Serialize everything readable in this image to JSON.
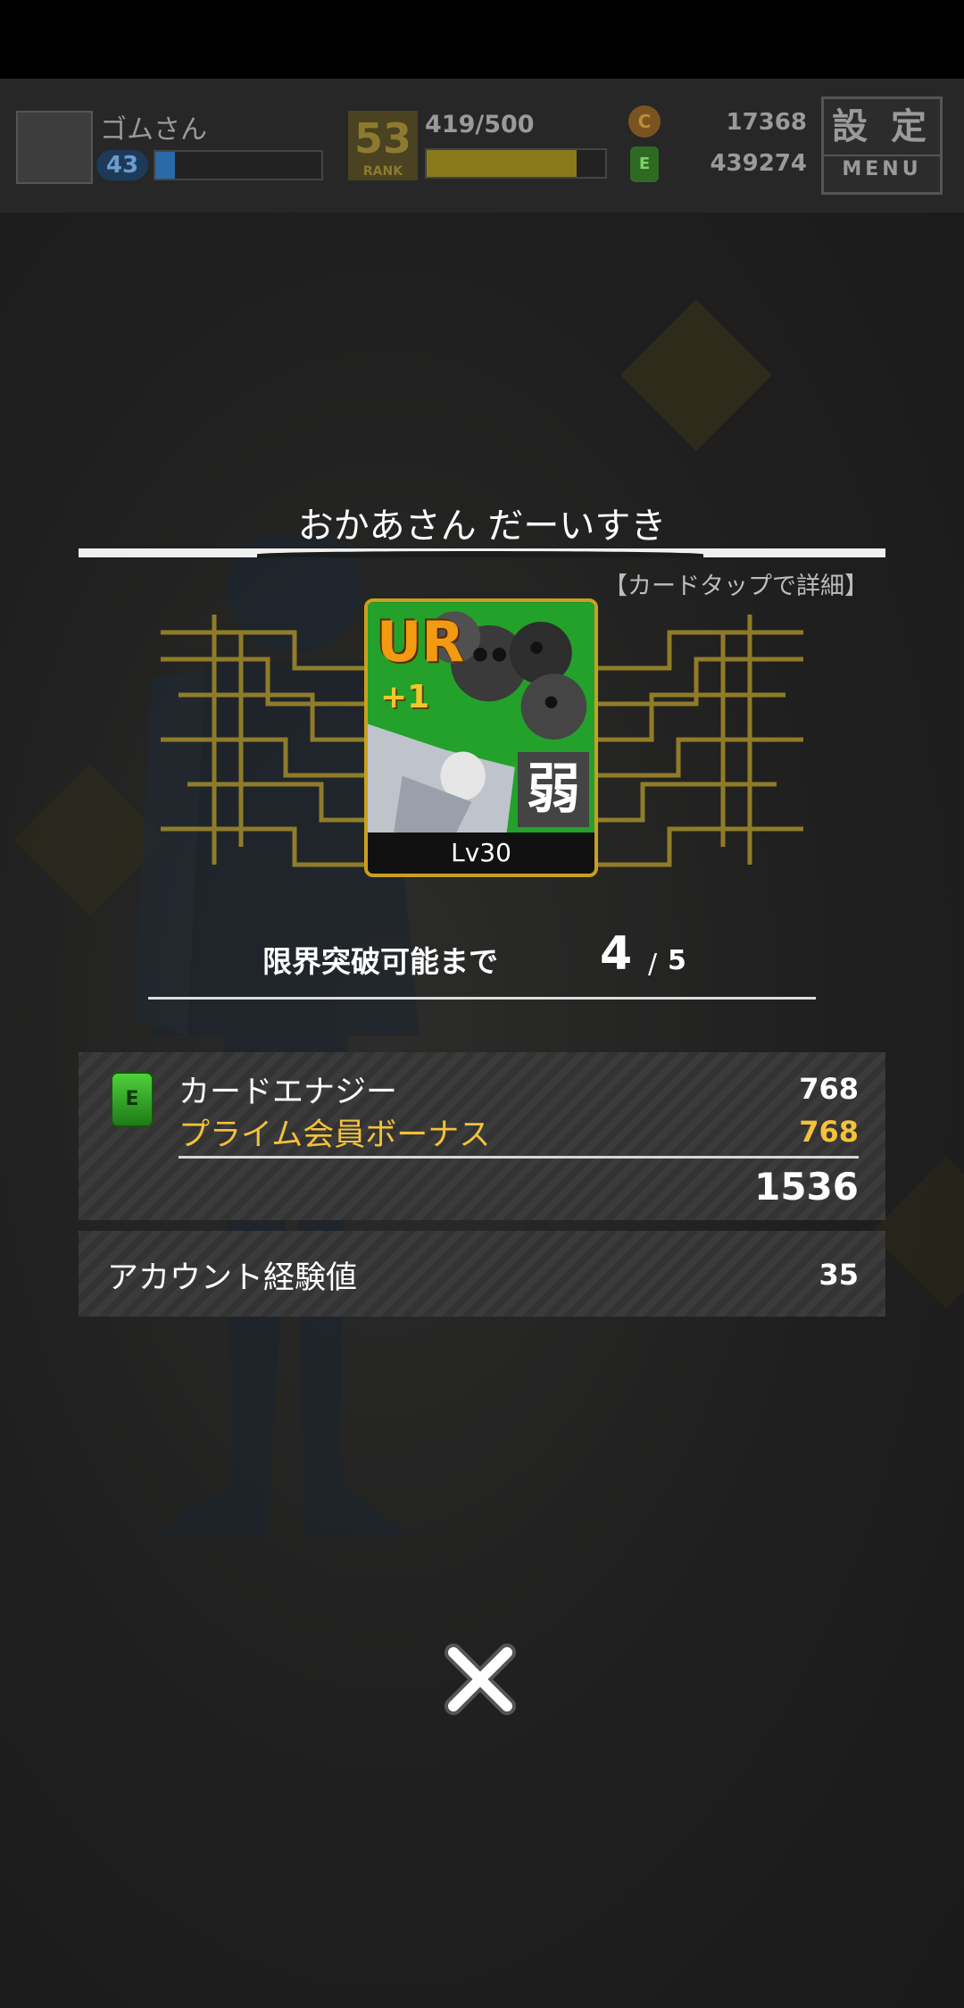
{
  "hud": {
    "player_name": "ゴムさん",
    "player_level": "43",
    "exp_fill_fraction": 0.12,
    "rank_value": "53",
    "rank_label": "RANK",
    "stamina_text": "419/500",
    "stamina_fill_fraction": 0.838,
    "coins": "17368",
    "card_energy": "439274",
    "menu_kanji": "設 定",
    "menu_label": "MENU"
  },
  "result": {
    "title": "おかあさん だーいすき",
    "detail_hint": "【カードタップで詳細】",
    "card": {
      "rarity": "UR",
      "plus": "+1",
      "attribute": "弱",
      "level": "Lv30"
    },
    "limit_break": {
      "label": "限界突破可能まで",
      "current": "4",
      "separator": "/",
      "max": "5"
    },
    "energy": {
      "label": "カードエナジー",
      "value": "768",
      "bonus_label": "プライム会員ボーナス",
      "bonus_value": "768",
      "total": "1536"
    },
    "account_exp": {
      "label": "アカウント経験値",
      "value": "35"
    }
  },
  "colors": {
    "gold_text": "#f4c13a",
    "card_frame": "#c8a020",
    "card_background": "#1f8a1f"
  }
}
